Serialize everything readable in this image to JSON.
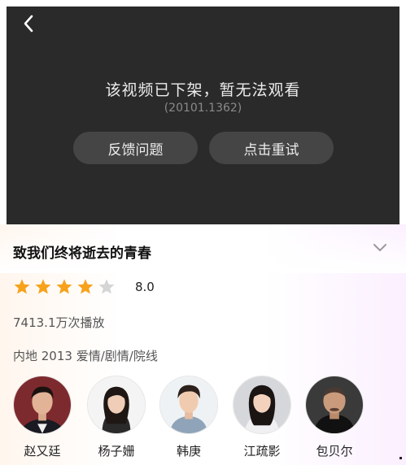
{
  "player": {
    "message": "该视频已下架，暂无法观看",
    "code": "(20101.1362)",
    "feedback_label": "反馈问题",
    "retry_label": "点击重试",
    "icons": {
      "back": "back-chevron-icon"
    }
  },
  "movie": {
    "title": "致我们终将逝去的青春",
    "rating": 4,
    "rating_max": 5,
    "score": "8.0",
    "plays": "7413.1万次播放",
    "meta": "内地 2013 爱情/剧情/院线",
    "icons": {
      "expand": "chevron-down-icon",
      "star": "star-icon"
    }
  },
  "cast": [
    {
      "name": "赵又廷"
    },
    {
      "name": "杨子姗"
    },
    {
      "name": "韩庚"
    },
    {
      "name": "江疏影"
    },
    {
      "name": "包贝尔"
    }
  ],
  "colors": {
    "star_on": "#f7a21b",
    "star_off": "#d5d5d5",
    "player_bg": "#2a2a2a",
    "button_bg": "#454545"
  }
}
